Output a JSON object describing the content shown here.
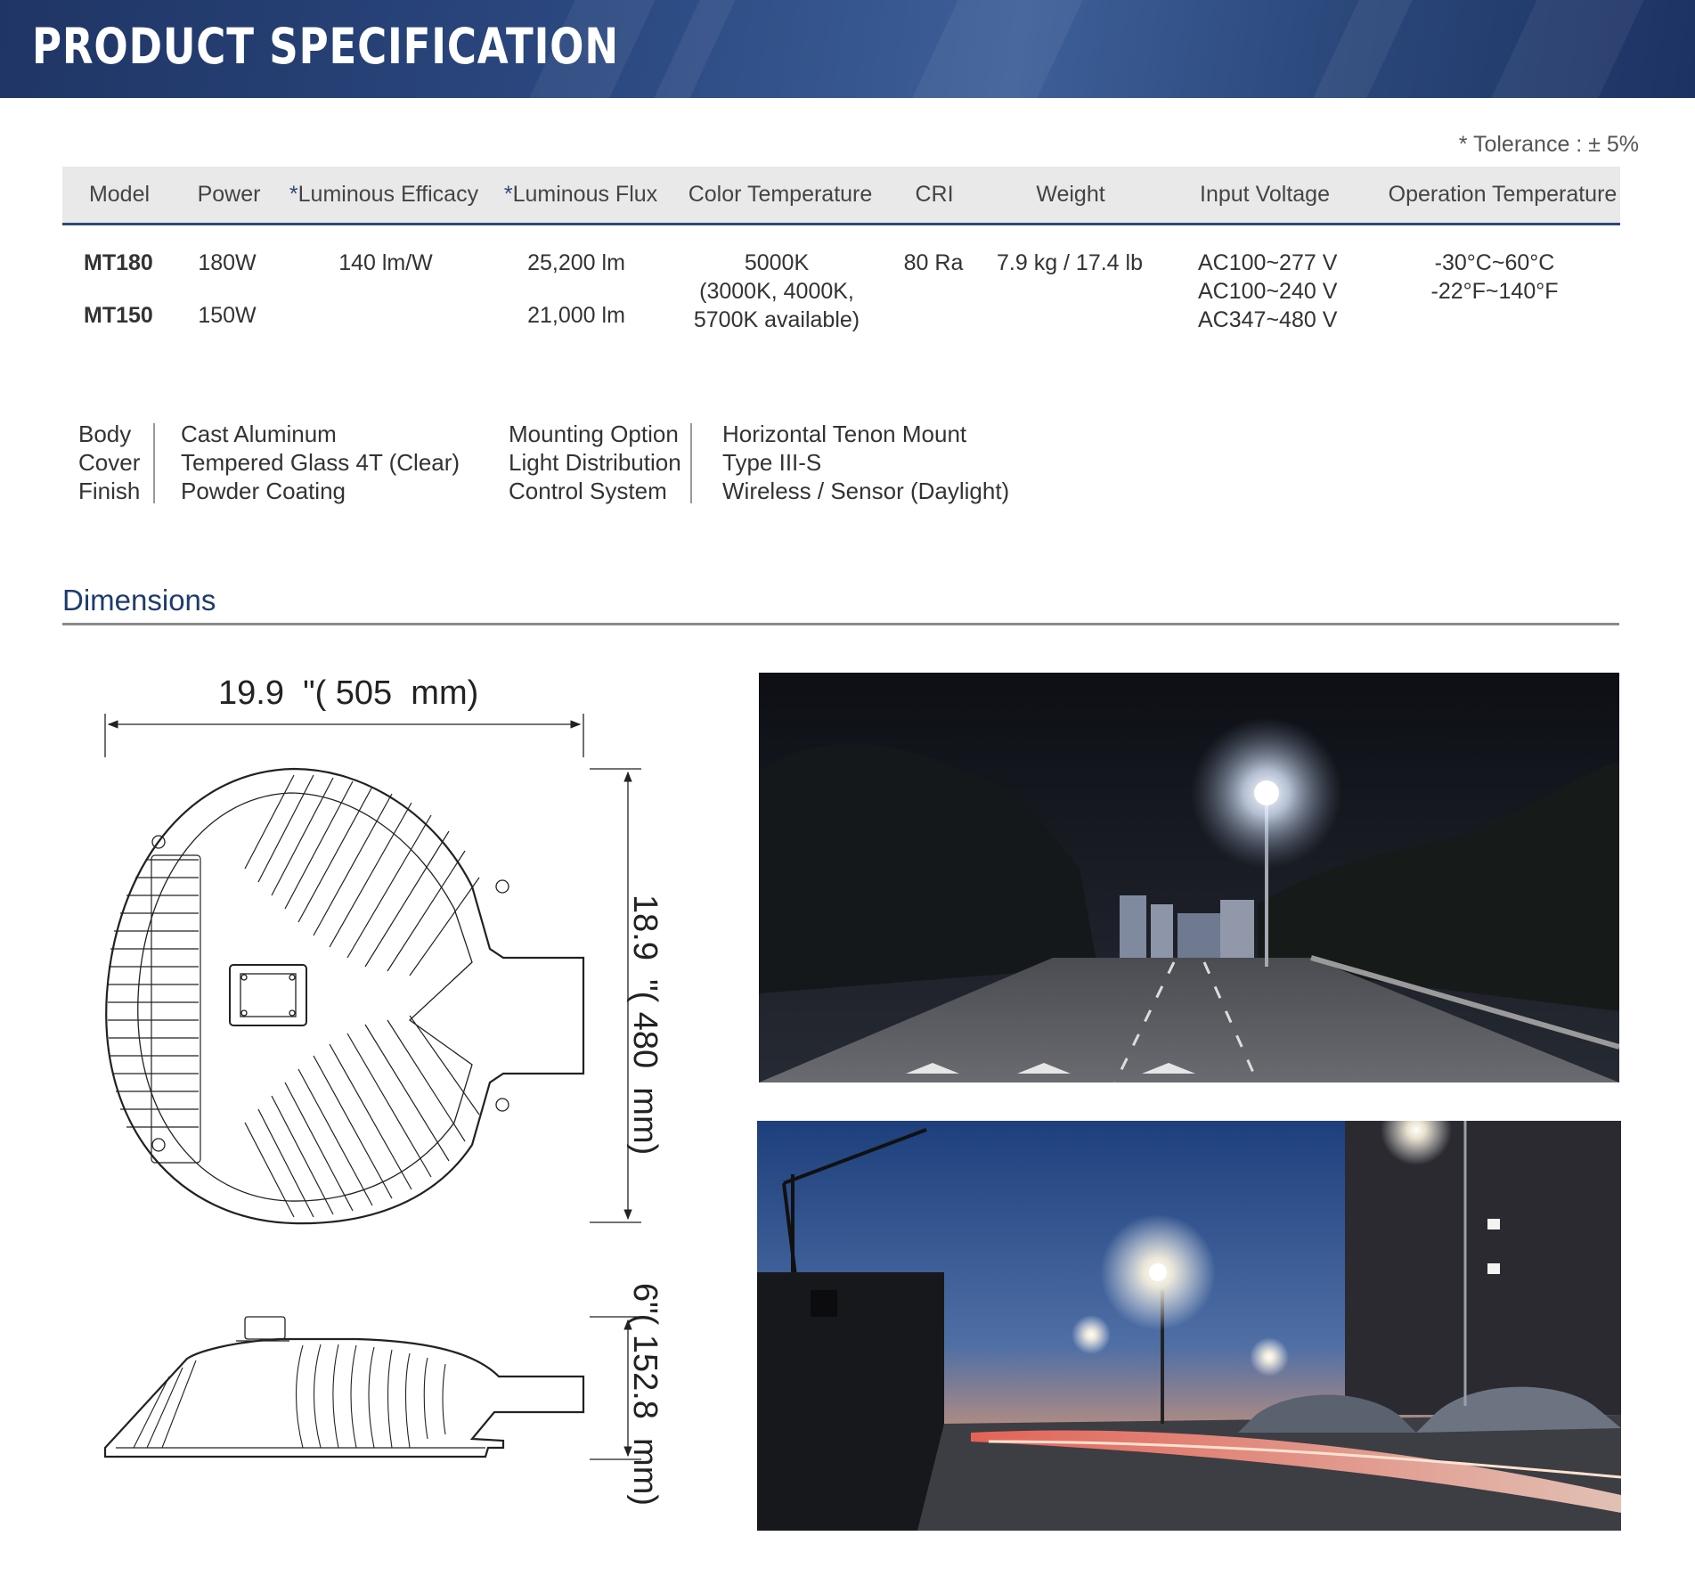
{
  "header": {
    "title": "PRODUCT SPECIFICATION"
  },
  "tolerance_note": "* Tolerance : ± 5%",
  "spec_table": {
    "columns": [
      "Model",
      "Power",
      "*Luminous Efficacy",
      "*Luminous Flux",
      "Color Temperature",
      "CRI",
      "Weight",
      "Input Voltage",
      "Operation Temperature"
    ],
    "rows": [
      {
        "model": "MT180",
        "power": "180W",
        "efficacy": "140 lm/W",
        "flux": "25,200 lm"
      },
      {
        "model": "MT150",
        "power": "150W",
        "flux": "21,000 lm"
      }
    ],
    "shared": {
      "color_temperature": [
        "5000K",
        "(3000K, 4000K,",
        "5700K available)"
      ],
      "cri": "80 Ra",
      "weight": "7.9 kg / 17.4 lb",
      "input_voltage": [
        "AC100~277 V",
        "AC100~240 V",
        "AC347~480 V"
      ],
      "operation_temperature": [
        "-30°C~60°C",
        "-22°F~140°F"
      ]
    }
  },
  "materials": [
    {
      "label": "Body",
      "value": "Cast Aluminum"
    },
    {
      "label": "Cover",
      "value": "Tempered Glass 4T (Clear)"
    },
    {
      "label": "Finish",
      "value": "Powder Coating"
    }
  ],
  "options": [
    {
      "label": "Mounting Option",
      "value": "Horizontal Tenon Mount"
    },
    {
      "label": "Light Distribution",
      "value": "Type III-S"
    },
    {
      "label": "Control System",
      "value": "Wireless / Sensor (Daylight)"
    }
  ],
  "dimensions": {
    "title": "Dimensions",
    "width_label": "19.9  \"( 505  mm)",
    "length_label": "18.9  \"( 480  mm)",
    "height_label": "6\"( 152.8  mm)"
  },
  "colors": {
    "brand_dark": "#1f3565",
    "accent": "#2c4a7c",
    "table_head_bg": "#e9e9ea"
  }
}
